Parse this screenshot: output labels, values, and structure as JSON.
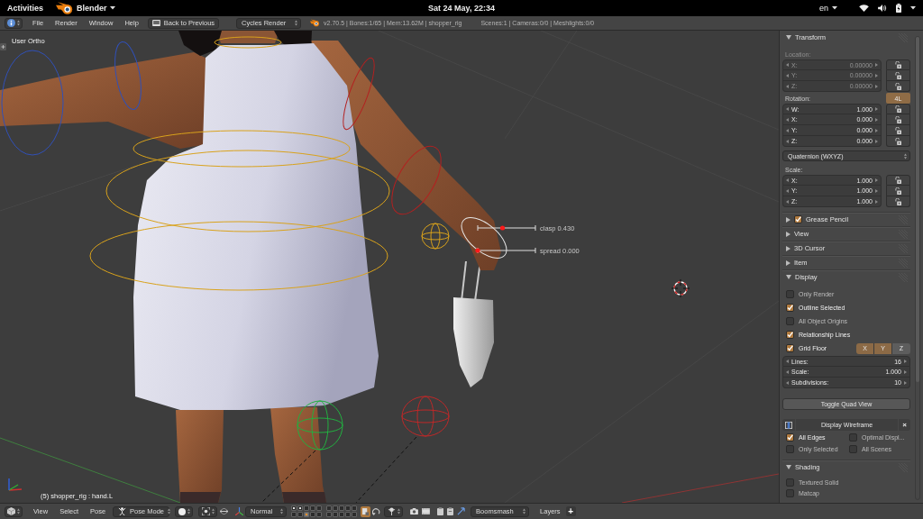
{
  "top_bar": {
    "activities": "Activities",
    "app_menu": "Blender",
    "clock": "Sat 24 May, 22:34",
    "input_source": "en"
  },
  "info_header": {
    "menus": [
      "File",
      "Render",
      "Window",
      "Help"
    ],
    "back_button": "Back to Previous",
    "render_engine": "Cycles Render",
    "stats": "v2.70.5 | Bones:1/65 | Mem:13.62M | shopper_rig",
    "scene_stats": "Scenes:1 | Cameras:0/0 | Meshlights:0/0"
  },
  "viewport": {
    "view_name": "User Ortho",
    "sliders": [
      {
        "label": "clasp 0.430",
        "level": 0.43
      },
      {
        "label": "spread 0.000",
        "level": 0
      }
    ],
    "active_bone": "(5) shopper_rig : hand.L"
  },
  "properties": {
    "transform": {
      "title": "Transform",
      "expanded": true,
      "groups": [
        {
          "label": "Location:",
          "disabled": true,
          "fields": [
            {
              "axis": "X:",
              "value": "0.00000"
            },
            {
              "axis": "Y:",
              "value": "0.00000"
            },
            {
              "axis": "Z:",
              "value": "0.00000"
            }
          ]
        },
        {
          "label": "Rotation:",
          "disabled": false,
          "lock_4d": {
            "label": "4L",
            "on": true
          },
          "fields": [
            {
              "axis": "W:",
              "value": "1.000"
            },
            {
              "axis": "X:",
              "value": "0.000"
            },
            {
              "axis": "Y:",
              "value": "0.000"
            },
            {
              "axis": "Z:",
              "value": "0.000"
            }
          ],
          "mode": "Quaternion (WXYZ)"
        },
        {
          "label": "Scale:",
          "disabled": false,
          "fields": [
            {
              "axis": "X:",
              "value": "1.000"
            },
            {
              "axis": "Y:",
              "value": "1.000"
            },
            {
              "axis": "Z:",
              "value": "1.000"
            }
          ]
        }
      ]
    },
    "collapsed_panels": [
      {
        "title": "Grease Pencil",
        "expanded": false,
        "kind": "toggle",
        "checked": true
      },
      {
        "title": "View",
        "expanded": false,
        "kind": "plain"
      },
      {
        "title": "3D Cursor",
        "expanded": false,
        "kind": "plain"
      },
      {
        "title": "Item",
        "expanded": false,
        "kind": "plain"
      }
    ],
    "display": {
      "title": "Display",
      "expanded": true,
      "options": [
        {
          "label": "Only Render",
          "checked": false
        },
        {
          "label": "Outline Selected",
          "checked": true
        },
        {
          "label": "All Object Origins",
          "checked": false
        },
        {
          "label": "Relationship Lines",
          "checked": true
        }
      ],
      "grid_floor": {
        "label": "Grid Floor",
        "checked": true,
        "axes": [
          {
            "label": "X",
            "selected": true
          },
          {
            "label": "Y",
            "selected": true
          },
          {
            "label": "Z",
            "selected": false
          }
        ]
      },
      "grid_fields": [
        {
          "label": "Lines:",
          "value": "16"
        },
        {
          "label": "Scale:",
          "value": "1.000"
        },
        {
          "label": "Subdivisions:",
          "value": "10"
        }
      ],
      "quad_view_button": "Toggle Quad View",
      "wireframe": {
        "label": "Display Wireframe",
        "remove": "×"
      },
      "wire_options": [
        {
          "label": "All Edges",
          "checked": true
        },
        {
          "label": "Optimal Displ...",
          "checked": false
        },
        {
          "label": "Only Selected",
          "checked": false
        },
        {
          "label": "All Scenes",
          "checked": false
        }
      ]
    },
    "shading": {
      "title": "Shading",
      "expanded": true,
      "options": [
        {
          "label": "Textured Solid",
          "checked": false
        },
        {
          "label": "Matcap",
          "checked": false
        }
      ]
    }
  },
  "view_header": {
    "menus": [
      "View",
      "Select",
      "Pose"
    ],
    "mode": "Pose Mode",
    "orientation": "Normal",
    "layer_blocks": [
      {
        "cells": [
          {
            "selected": false,
            "used": true
          },
          {
            "selected": false,
            "used": true
          },
          {
            "selected": false,
            "used": false
          },
          {
            "selected": false,
            "used": false
          },
          {
            "selected": false,
            "used": false
          },
          {
            "selected": false,
            "used": false
          },
          {
            "selected": false,
            "used": false
          },
          {
            "selected": true,
            "used": true
          },
          {
            "selected": false,
            "used": false
          },
          {
            "selected": false,
            "used": false
          }
        ]
      },
      {
        "cells": [
          {
            "selected": false,
            "used": false
          },
          {
            "selected": false,
            "used": false
          },
          {
            "selected": false,
            "used": false
          },
          {
            "selected": false,
            "used": false
          },
          {
            "selected": false,
            "used": false
          },
          {
            "selected": false,
            "used": false
          },
          {
            "selected": false,
            "used": false
          },
          {
            "selected": false,
            "used": false
          },
          {
            "selected": false,
            "used": false
          },
          {
            "selected": false,
            "used": false
          }
        ]
      }
    ],
    "layer_lock": {
      "on": true
    },
    "keying_set": "Boomsmash",
    "layers_label": "Layers",
    "add_button": "+"
  }
}
